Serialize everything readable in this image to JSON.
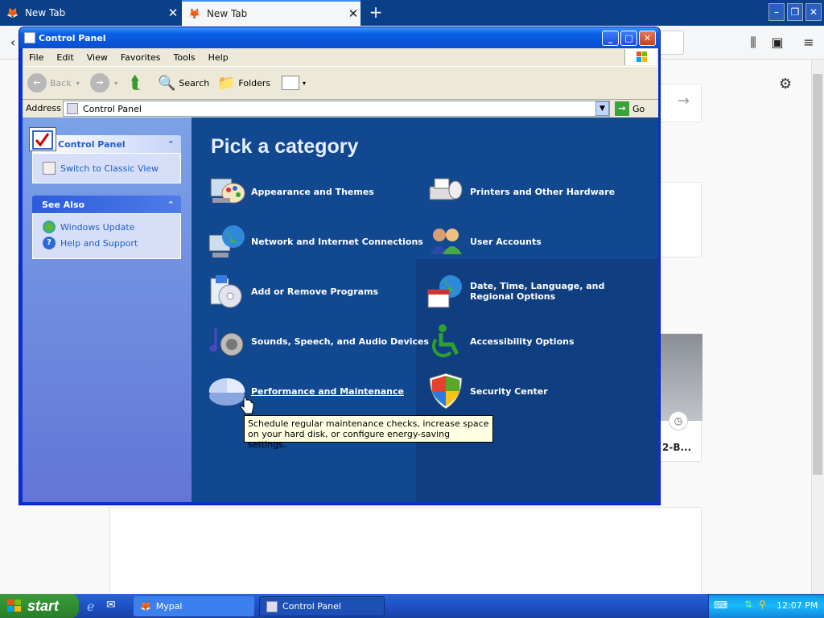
{
  "browser": {
    "tabs": [
      {
        "label": "New Tab",
        "active": false
      },
      {
        "label": "New Tab",
        "active": true
      }
    ],
    "newtab_icon": "plus-icon",
    "tile_text": "2-B..."
  },
  "window": {
    "title": "Control Panel",
    "menu": [
      "File",
      "Edit",
      "View",
      "Favorites",
      "Tools",
      "Help"
    ],
    "toolbar": {
      "back": "Back",
      "search": "Search",
      "folders": "Folders"
    },
    "address_label": "Address",
    "address_value": "Control Panel",
    "go_label": "Go"
  },
  "sidebar": {
    "panel_title": "Control Panel",
    "switch_link": "Switch to Classic View",
    "see_also_title": "See Also",
    "see_also_links": [
      "Windows Update",
      "Help and Support"
    ]
  },
  "main": {
    "heading": "Pick a category",
    "categories_left": [
      "Appearance and Themes",
      "Network and Internet Connections",
      "Add or Remove Programs",
      "Sounds, Speech, and Audio Devices",
      "Performance and Maintenance"
    ],
    "categories_right": [
      "Printers and Other Hardware",
      "User Accounts",
      "Date, Time, Language, and Regional Options",
      "Accessibility Options",
      "Security Center"
    ],
    "tooltip": "Schedule regular maintenance checks, increase space on your hard disk, or configure energy-saving settings."
  },
  "taskbar": {
    "start_label": "start",
    "items": [
      "Mypal",
      "Control Panel"
    ],
    "clock": "12:07 PM"
  },
  "colors": {
    "xp_blue": "#0a5fe6",
    "main_bg": "#11488f",
    "start_green": "#318f31"
  }
}
